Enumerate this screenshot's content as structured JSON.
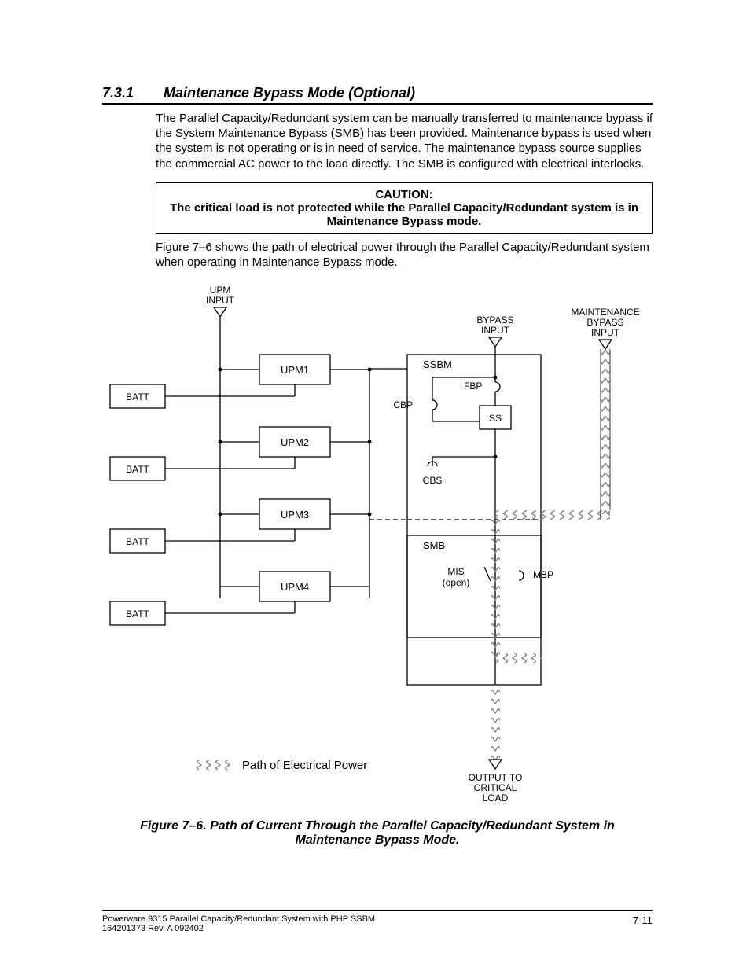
{
  "section": {
    "num": "7.3.1",
    "title": "Maintenance Bypass Mode (Optional)"
  },
  "para1": "The Parallel Capacity/Redundant system can be manually transferred to maintenance bypass if the System Maintenance Bypass (SMB) has been provided. Maintenance bypass is used when the system is not operating or is in need of service.  The maintenance bypass source supplies the commercial AC power to the load directly.  The SMB is configured with electrical interlocks.",
  "caution": {
    "head": "CAUTION:",
    "body": "The critical load is not protected while the Parallel Capacity/Redundant system is in Maintenance Bypass mode."
  },
  "para2": "Figure 7–6 shows the path of electrical power through the Parallel Capacity/Redundant system when operating in Maintenance Bypass mode.",
  "diagram": {
    "upm_input": "UPM\nINPUT",
    "bypass_input": "BYPASS\nINPUT",
    "maint_input": "MAINTENANCE\nBYPASS\nINPUT",
    "upm1": "UPM1",
    "upm2": "UPM2",
    "upm3": "UPM3",
    "upm4": "UPM4",
    "batt": "BATT",
    "ssbm": "SSBM",
    "fbp": "FBP",
    "cbp": "CBP",
    "ss": "SS",
    "cbs": "CBS",
    "smb": "SMB",
    "mis": "MIS",
    "mis_open": "(open)",
    "mbp": "MBP",
    "legend": "Path of Electrical Power",
    "output": "OUTPUT TO\nCRITICAL\nLOAD"
  },
  "figure_caption": "Figure 7–6.   Path of Current Through the Parallel Capacity/Redundant System in  Maintenance Bypass Mode.",
  "footer": {
    "l1": "Powerware 9315 Parallel Capacity/Redundant System with PHP SSBM",
    "l2": "164201373    Rev. A      092402",
    "page": "7-11"
  }
}
